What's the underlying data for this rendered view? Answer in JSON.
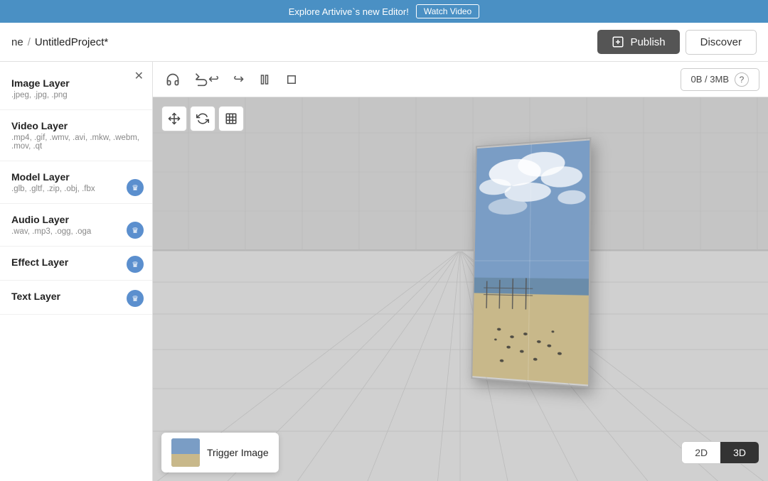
{
  "banner": {
    "text": "Explore Artivive`s new Editor!",
    "watch_label": "Watch Video"
  },
  "header": {
    "home_label": "ne",
    "separator": "/",
    "project_name": "UntitledProject*",
    "publish_label": "Publish",
    "discover_label": "Discover"
  },
  "toolbar": {
    "storage_label": "0B / 3MB",
    "help_icon": "?"
  },
  "transform": {
    "move_icon": "⤢",
    "rotate_icon": "↻",
    "scale_icon": "⊡"
  },
  "sidebar": {
    "close_icon": "✕",
    "layers": [
      {
        "title": "Image Layer",
        "extensions": ".jpeg, .jpg, .png",
        "crown": false
      },
      {
        "title": "Video Layer",
        "extensions": ".mp4, .gif, .wmv, .avi, .mkw, .webm, .mov, .qt",
        "crown": false
      },
      {
        "title": "Model Layer",
        "extensions": ".glb, .gltf, .zip, .obj, .fbx",
        "crown": true
      },
      {
        "title": "Audio Layer",
        "extensions": ".wav, .mp3, .ogg, .oga",
        "crown": true
      },
      {
        "title": "Effect Layer",
        "extensions": "",
        "crown": true
      },
      {
        "title": "Text Layer",
        "extensions": "",
        "crown": true
      }
    ]
  },
  "bottom": {
    "trigger_label": "Trigger Image",
    "view_2d": "2D",
    "view_3d": "3D"
  }
}
